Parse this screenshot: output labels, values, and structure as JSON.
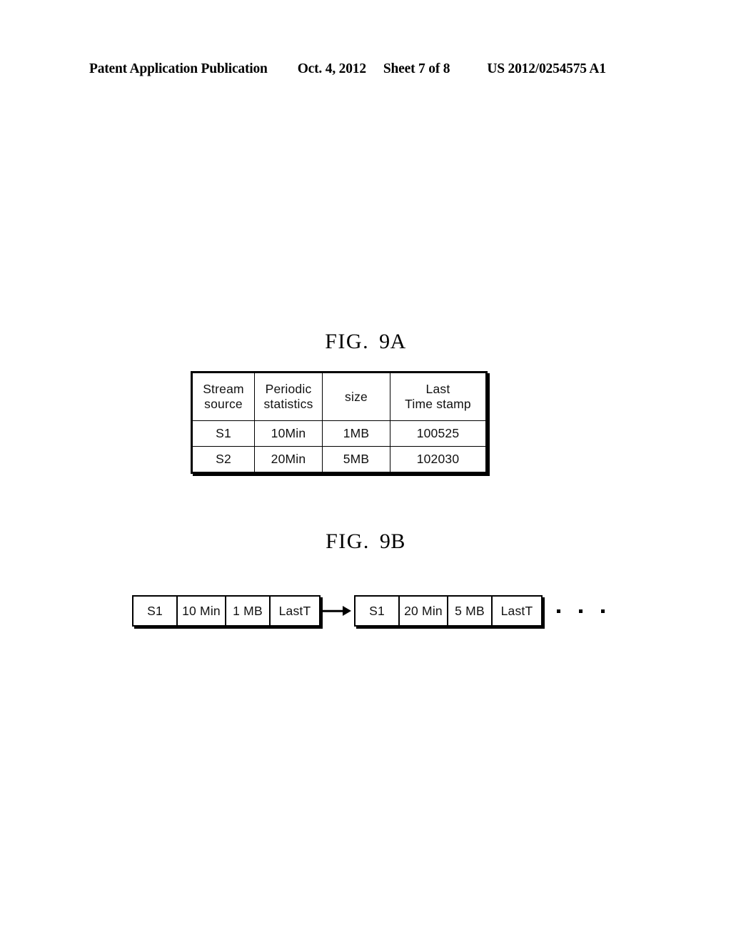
{
  "header": {
    "publication": "Patent Application Publication",
    "date": "Oct. 4, 2012",
    "sheet": "Sheet 7 of 8",
    "patent_number": "US 2012/0254575 A1"
  },
  "figures": {
    "fig9a": {
      "word": "FIG.",
      "id": "9A"
    },
    "fig9b": {
      "word": "FIG.",
      "id": "9B"
    }
  },
  "fig9a_table": {
    "columns": [
      {
        "line1": "Stream",
        "line2": "source"
      },
      {
        "line1": "Periodic",
        "line2": "statistics"
      },
      {
        "line1": "size",
        "line2": ""
      },
      {
        "line1": "Last",
        "line2": "Time stamp"
      }
    ],
    "rows": [
      {
        "stream_source": "S1",
        "periodic_statistics": "10Min",
        "size": "1MB",
        "last_time_stamp": "100525"
      },
      {
        "stream_source": "S2",
        "periodic_statistics": "20Min",
        "size": "5MB",
        "last_time_stamp": "102030"
      }
    ]
  },
  "fig9b_list": {
    "nodes": [
      {
        "stream_source": "S1",
        "periodic_statistics": "10 Min",
        "size": "1 MB",
        "last_time_stamp": "LastT"
      },
      {
        "stream_source": "S1",
        "periodic_statistics": "20 Min",
        "size": "5 MB",
        "last_time_stamp": "LastT"
      }
    ],
    "continuation_dots": 3
  },
  "colors": {
    "ink": "#000000",
    "paper": "#ffffff"
  }
}
